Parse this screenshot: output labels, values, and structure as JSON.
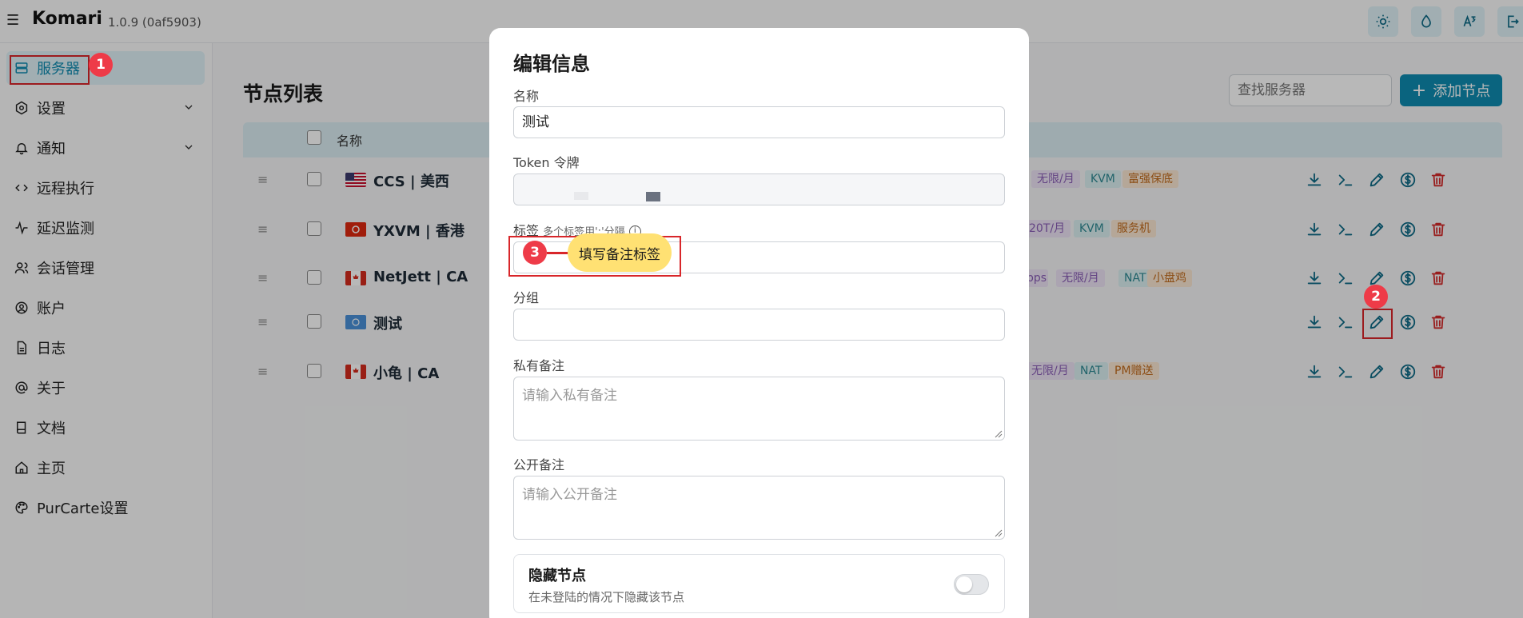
{
  "app": {
    "name": "Komari",
    "version": "1.0.9 (0af5903)"
  },
  "top_icons": [
    "sun-icon",
    "droplet-icon",
    "translate-icon",
    "logout-icon"
  ],
  "sidebar": {
    "items": [
      {
        "label": "服务器",
        "icon": "server-icon",
        "active": true
      },
      {
        "label": "设置",
        "icon": "settings-icon",
        "expandable": true
      },
      {
        "label": "通知",
        "icon": "bell-icon",
        "expandable": true
      },
      {
        "label": "远程执行",
        "icon": "code-icon"
      },
      {
        "label": "延迟监测",
        "icon": "pulse-icon"
      },
      {
        "label": "会话管理",
        "icon": "users-icon"
      },
      {
        "label": "账户",
        "icon": "account-icon"
      },
      {
        "label": "日志",
        "icon": "file-icon"
      },
      {
        "label": "关于",
        "icon": "at-icon"
      },
      {
        "label": "文档",
        "icon": "book-icon"
      },
      {
        "label": "主页",
        "icon": "home-icon"
      },
      {
        "label": "PurCarte设置",
        "icon": "palette-icon"
      }
    ]
  },
  "main": {
    "title": "节点列表",
    "search_placeholder": "查找服务器",
    "add_label": "添加节点",
    "column_name": "名称",
    "rows": [
      {
        "name": "CCS | 美西",
        "flag": "us",
        "tags": [
          [
            "无限/月",
            "purple"
          ],
          [
            "KVM",
            "teal"
          ],
          [
            "富强保底",
            "orange"
          ]
        ]
      },
      {
        "name": "YXVM | 香港",
        "flag": "hk",
        "tags": [
          [
            "20T/月",
            "purple"
          ],
          [
            "KVM",
            "teal"
          ],
          [
            "服务机",
            "orange"
          ]
        ]
      },
      {
        "name": "NetJett | CA",
        "flag": "ca",
        "tags": [
          [
            "bps",
            "purple"
          ],
          [
            "无限/月",
            "purple"
          ],
          [
            "NAT",
            "teal"
          ],
          [
            "小盘鸡",
            "orange"
          ]
        ]
      },
      {
        "name": "测试",
        "flag": "un",
        "tags": []
      },
      {
        "name": "小龟 | CA",
        "flag": "ca",
        "tags": [
          [
            "无限/月",
            "purple"
          ],
          [
            "NAT",
            "teal"
          ],
          [
            "PM赠送",
            "orange"
          ]
        ]
      }
    ]
  },
  "modal": {
    "title": "编辑信息",
    "name_label": "名称",
    "name_value": "测试",
    "token_label": "Token 令牌",
    "tags_label": "标签",
    "tags_hint": "多个标签用';'分隔",
    "group_label": "分组",
    "private_label": "私有备注",
    "private_placeholder": "请输入私有备注",
    "public_label": "公开备注",
    "public_placeholder": "请输入公开备注",
    "hide_title": "隐藏节点",
    "hide_desc": "在未登陆的情况下隐藏该节点",
    "hide_enabled": false
  },
  "annotations": {
    "step1": "1",
    "step2": "2",
    "step3": "3",
    "step3_text": "填写备注标签"
  },
  "colors": {
    "accent": "#0e8bb0",
    "highlight": "#d8262a",
    "badge": "#ee3b48",
    "callout": "#ffe173"
  }
}
